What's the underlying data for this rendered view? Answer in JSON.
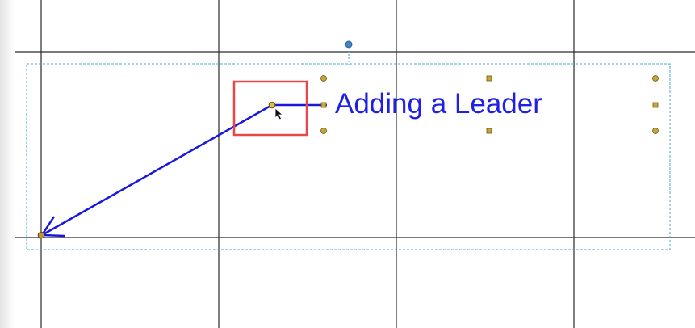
{
  "annotation": {
    "text": "Adding a Leader",
    "text_color": "#1f1fe6",
    "leader_color": "#1717e0",
    "highlight_color": "#e8474a"
  },
  "colors": {
    "grid_line": "#2a2a2a",
    "selection_border": "#4aa8d8",
    "handle_fill": "#c8a53a",
    "rotate_handle": "#3f86c6",
    "endpoint_handle": "#d6c43a"
  },
  "icons": {
    "cursor": "mouse-pointer-icon",
    "rotate": "rotation-handle-icon",
    "arrowhead": "arrowhead-icon"
  }
}
